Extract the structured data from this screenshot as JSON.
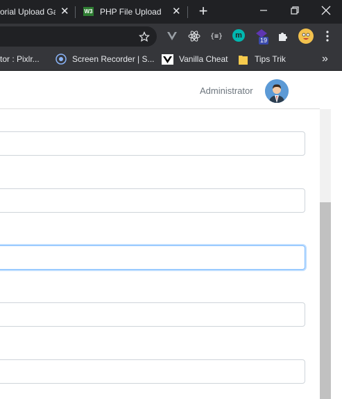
{
  "browser": {
    "tabs": [
      {
        "title": "orial Upload Ga",
        "active": false
      },
      {
        "title": "PHP File Upload",
        "active": true
      }
    ],
    "new_tab_label": "+",
    "extension_badge": "19",
    "bookmarks": [
      {
        "label": "tor : Pixlr..."
      },
      {
        "label": "Screen Recorder | S..."
      },
      {
        "label": "Vanilla Cheat"
      },
      {
        "label": "Tips Trik"
      }
    ],
    "bookmarks_overflow": "»"
  },
  "page": {
    "user": {
      "name": "Administrator"
    },
    "fields": [
      {
        "value": "",
        "focused": false
      },
      {
        "value": "",
        "focused": false
      },
      {
        "value": "",
        "focused": true
      },
      {
        "value": "",
        "focused": false
      },
      {
        "value": "",
        "focused": false
      }
    ]
  },
  "colors": {
    "tab_strip": "#202124",
    "toolbar": "#35363a",
    "focus_border": "#80bdff",
    "field_border": "#ced4da"
  }
}
